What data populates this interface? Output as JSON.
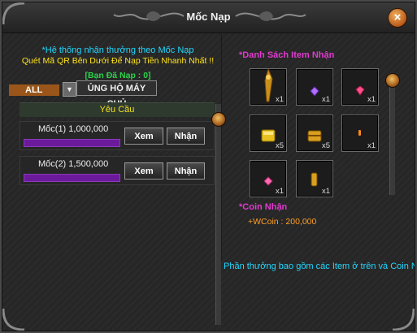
{
  "window": {
    "title": "Mốc Nạp",
    "close_label": "×"
  },
  "left": {
    "note1": "*Hệ thống nhận thưởng theo Mốc Nạp",
    "note2": "Quét Mã QR Bên Dưới Để Nạp Tiền Nhanh Nhất !!",
    "paid": "[Bạn Đã Nạp : 0]",
    "filter_value": "ALL",
    "server_button": "ỦNG HỘ MÁY CHỦ",
    "requirement_header": "Yêu Cầu",
    "tiers": [
      {
        "label": "Mốc(1) 1,000,000",
        "view": "Xem",
        "claim": "Nhận"
      },
      {
        "label": "Mốc(2) 1,500,000",
        "view": "Xem",
        "claim": "Nhận"
      }
    ]
  },
  "right": {
    "list_header": "*Danh Sách Item Nhận",
    "items": [
      {
        "icon": "golden-spear-icon",
        "count": "x1"
      },
      {
        "icon": "purple-gem-icon",
        "count": "x1"
      },
      {
        "icon": "red-gem-icon",
        "count": "x1"
      },
      {
        "icon": "gold-bar-icon",
        "count": "x5"
      },
      {
        "icon": "treasure-chest-icon",
        "count": "x5"
      },
      {
        "icon": "fire-token-icon",
        "count": "x1"
      },
      {
        "icon": "pink-gem-icon",
        "count": "x1"
      },
      {
        "icon": "gold-scroll-icon",
        "count": "x1"
      }
    ],
    "coin_header": "*Coin Nhận",
    "coin_value": "+WCoin : 200,000",
    "footer": "Phần thưởng bao gồm các Item ở trên và Coin Nhận"
  },
  "colors": {
    "accent_cyan": "#23d8ff",
    "accent_yellow": "#ffe31a",
    "accent_green": "#2dd14b",
    "accent_magenta": "#e23ad0",
    "accent_orange": "#ff9f26",
    "progress_purple": "#6a1a9a"
  }
}
